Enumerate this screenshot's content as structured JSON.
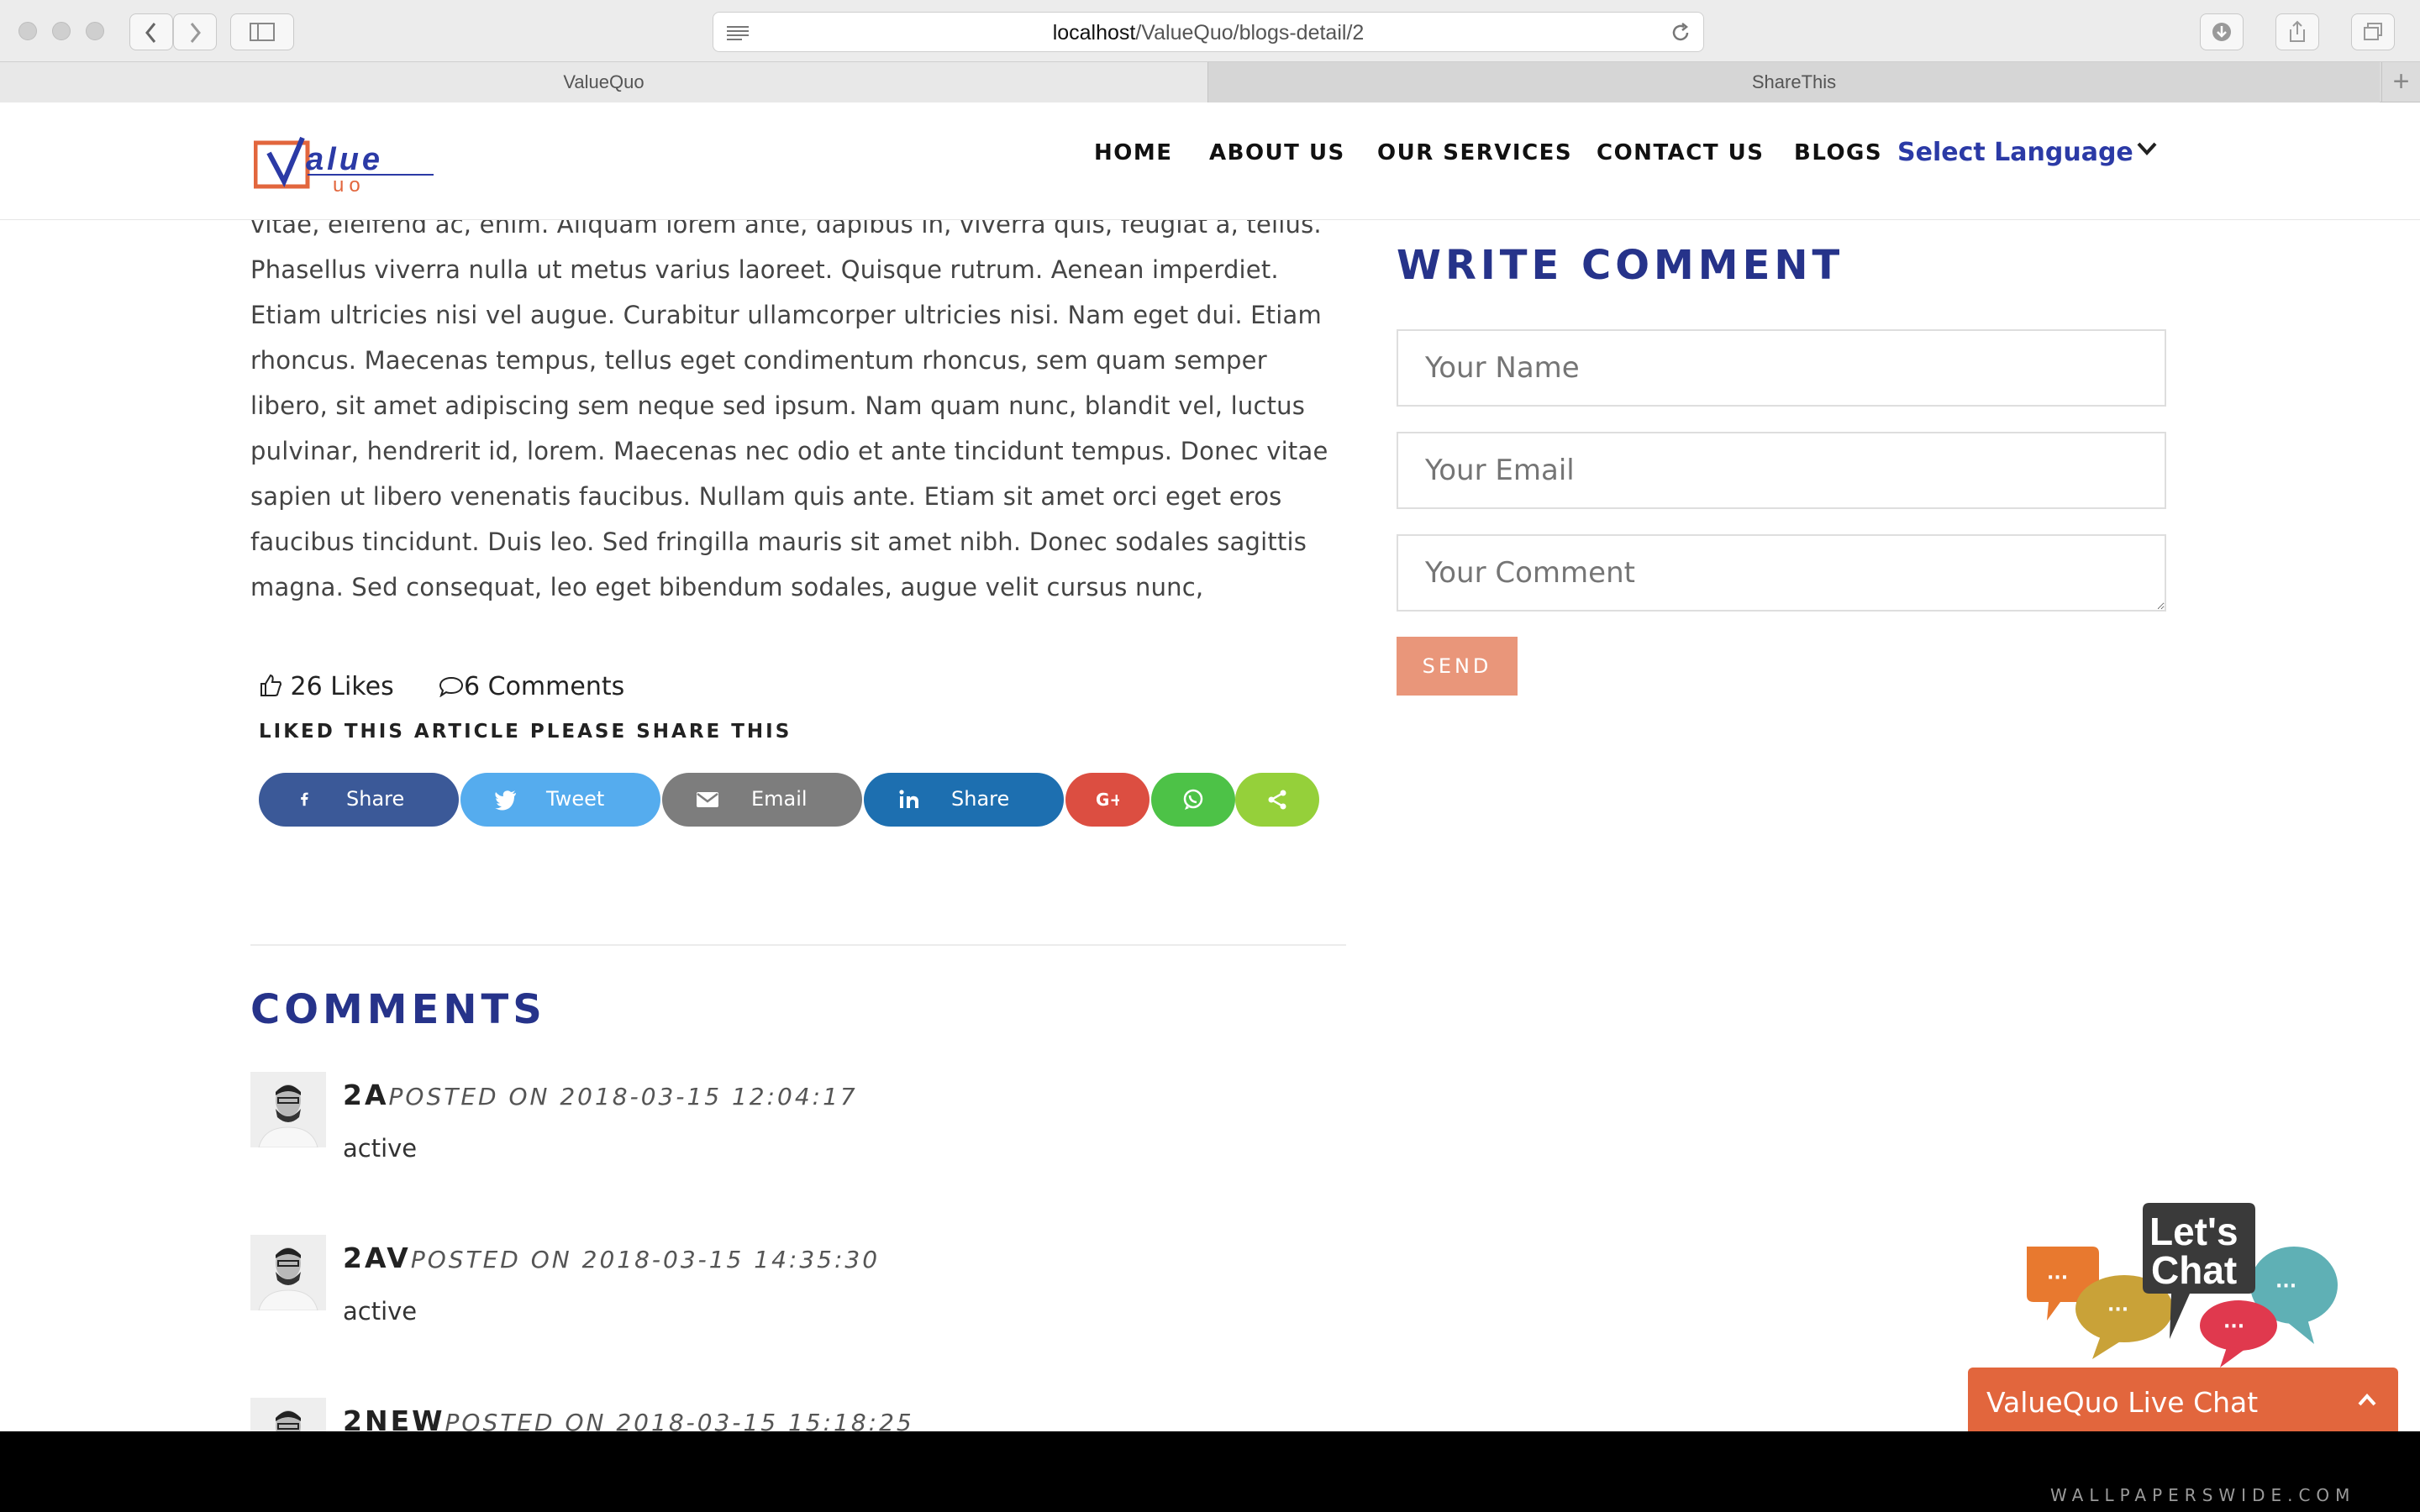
{
  "browser": {
    "url_host": "localhost",
    "url_path": "/ValueQuo/blogs-detail/2",
    "tabs": [
      "ValueQuo",
      "ShareThis"
    ]
  },
  "header": {
    "nav": [
      "HOME",
      "ABOUT US",
      "OUR SERVICES",
      "CONTACT US",
      "BLOGS"
    ],
    "language_select": "Select Language",
    "logo_text": "ValueQuo"
  },
  "article": {
    "body": "vitae, eleifend ac, enim. Aliquam lorem ante, dapibus in, viverra quis, feugiat a, tellus. Phasellus viverra nulla ut metus varius laoreet. Quisque rutrum. Aenean imperdiet. Etiam ultricies nisi vel augue. Curabitur ullamcorper ultricies nisi. Nam eget dui. Etiam rhoncus. Maecenas tempus, tellus eget condimentum rhoncus, sem quam semper libero, sit amet adipiscing sem neque sed ipsum. Nam quam nunc, blandit vel, luctus pulvinar, hendrerit id, lorem. Maecenas nec odio et ante tincidunt tempus. Donec vitae sapien ut libero venenatis faucibus. Nullam quis ante. Etiam sit amet orci eget eros faucibus tincidunt. Duis leo. Sed fringilla mauris sit amet nibh. Donec sodales sagittis magna. Sed consequat, leo eget bibendum sodales, augue velit cursus nunc,",
    "likes": "26 Likes",
    "comments_count": "6 Comments",
    "share_title": "LIKED THIS ARTICLE PLEASE SHARE THIS"
  },
  "share_buttons": [
    {
      "label": "Share",
      "icon": "facebook-icon",
      "color": "#3b5998"
    },
    {
      "label": "Tweet",
      "icon": "twitter-icon",
      "color": "#55acee"
    },
    {
      "label": "Email",
      "icon": "email-icon",
      "color": "#7d7d7d"
    },
    {
      "label": "Share",
      "icon": "linkedin-icon",
      "color": "#0077b5"
    },
    {
      "label": "",
      "icon": "google-plus-icon",
      "color": "#dc4e41"
    },
    {
      "label": "",
      "icon": "whatsapp-icon",
      "color": "#4dc247"
    },
    {
      "label": "",
      "icon": "sharethis-icon",
      "color": "#95d03a"
    }
  ],
  "comments": {
    "title": "COMMENTS",
    "items": [
      {
        "name": "2A",
        "posted": "POSTED ON 2018-03-15 12:04:17",
        "text": "active"
      },
      {
        "name": "2AV",
        "posted": "POSTED ON 2018-03-15 14:35:30",
        "text": "active"
      },
      {
        "name": "2NEW",
        "posted": "POSTED ON 2018-03-15 15:18:25",
        "text": ""
      }
    ]
  },
  "write_comment": {
    "title": "WRITE COMMENT",
    "name_placeholder": "Your Name",
    "email_placeholder": "Your Email",
    "comment_placeholder": "Your Comment",
    "send_label": "SEND"
  },
  "chat": {
    "art_text_1": "Let's",
    "art_text_2": "Chat",
    "bar_label": "ValueQuo Live Chat"
  },
  "watermark": "WALLPAPERSWIDE.COM",
  "colors": {
    "heading_blue": "#26338a",
    "nav_lang_blue": "#2b3aa6",
    "send_button": "#e9967a",
    "chat_bar": "#e2663d"
  }
}
